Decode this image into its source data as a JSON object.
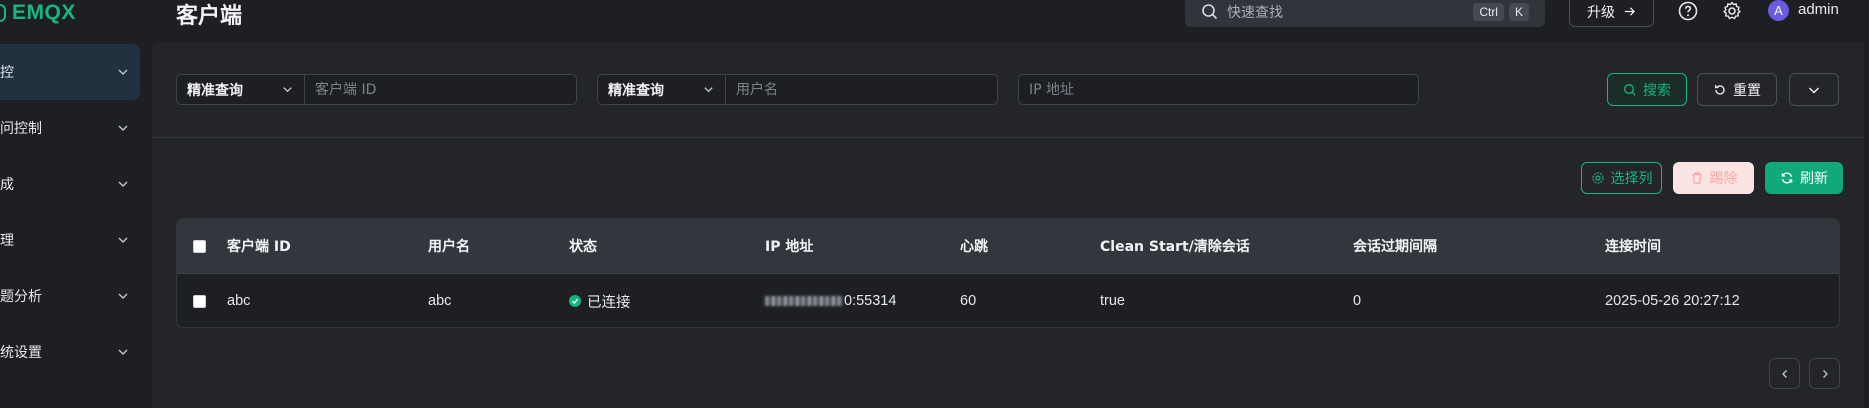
{
  "app": {
    "brand": "EMQX",
    "page_title": "客户端"
  },
  "header": {
    "search_placeholder": "快速查找",
    "shortcut_keys": [
      "Ctrl",
      "K"
    ],
    "upgrade_label": "升级",
    "user": {
      "avatar_letter": "A",
      "name": "admin"
    }
  },
  "sidebar": {
    "items": [
      {
        "label": "控",
        "active": true
      },
      {
        "label": "问控制",
        "active": false
      },
      {
        "label": "成",
        "active": false
      },
      {
        "label": "理",
        "active": false
      },
      {
        "label": "题分析",
        "active": false
      },
      {
        "label": "统设置",
        "active": false
      }
    ]
  },
  "filters": {
    "client_id": {
      "mode": "精准查询",
      "placeholder": "客户端 ID",
      "value": ""
    },
    "username": {
      "mode": "精准查询",
      "placeholder": "用户名",
      "value": ""
    },
    "ip": {
      "placeholder": "IP 地址",
      "value": ""
    },
    "search_label": "搜索",
    "reset_label": "重置"
  },
  "toolbar": {
    "columns_label": "选择列",
    "kick_label": "踢除",
    "refresh_label": "刷新"
  },
  "table": {
    "headers": [
      "客户端 ID",
      "用户名",
      "状态",
      "IP 地址",
      "心跳",
      "Clean Start/清除会话",
      "会话过期间隔",
      "连接时间"
    ],
    "rows": [
      {
        "client_id": "abc",
        "username": "abc",
        "status": "已连接",
        "ip_suffix": "0:55314",
        "keepalive": "60",
        "clean_start": "true",
        "expiry": "0",
        "connected_at": "2025-05-26 20:27:12"
      }
    ]
  },
  "colors": {
    "accent": "#16b67f",
    "background": "#1d1f23",
    "panel": "#232529",
    "danger_soft": "#fbe5e3"
  }
}
